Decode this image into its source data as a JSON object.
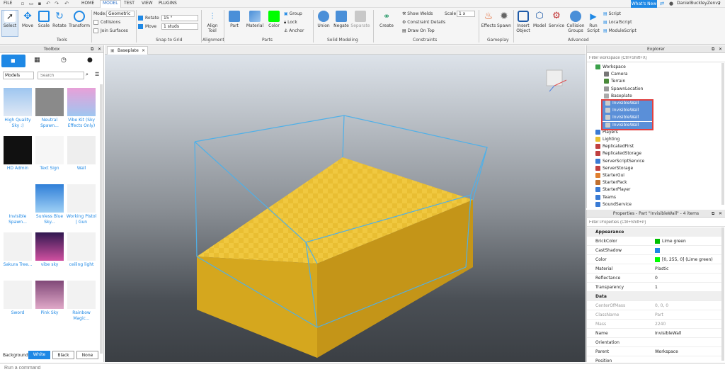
{
  "menu": {
    "file": "FILE",
    "home": "HOME",
    "model": "MODEL",
    "test": "TEST",
    "view": "VIEW",
    "plugins": "PLUGINS",
    "whats_new": "What's New",
    "user": "DanielBuckleyZenva"
  },
  "ribbon": {
    "tools": {
      "select": "Select",
      "move": "Move",
      "scale": "Scale",
      "rotate": "Rotate",
      "transform": "Transform",
      "label": "Tools"
    },
    "mode_label": "Mode:",
    "mode_value": "Geometric",
    "collisions": "Collisions",
    "join_surfaces": "Join Surfaces",
    "rotate": "Rotate",
    "rotate_value": "15 °",
    "move": "Move",
    "move_value": "1 studs",
    "snap_label": "Snap to Grid",
    "align_tool": "Align Tool",
    "alignment_label": "Alignment",
    "part": "Part",
    "material": "Material",
    "color": "Color",
    "group": "Group",
    "lock": "Lock",
    "anchor": "Anchor",
    "parts_label": "Parts",
    "color_swatch": "#00ff00",
    "union": "Union",
    "negate": "Negate",
    "separate": "Separate",
    "solid_label": "Solid Modeling",
    "create": "Create",
    "show_welds": "Show Welds",
    "constraint_details": "Constraint Details",
    "draw_on_top": "Draw On Top",
    "scale": "Scale",
    "scale_value": "1 x",
    "constraints_label": "Constraints",
    "effects": "Effects",
    "spawn": "Spawn",
    "gameplay_label": "Gameplay",
    "insert_object": "Insert Object",
    "model": "Model",
    "service": "Service",
    "collision_groups": "Collision Groups",
    "run_script": "Run Script",
    "script": "Script",
    "local_script": "LocalScript",
    "module_script": "ModuleScript",
    "advanced_label": "Advanced"
  },
  "toolbox": {
    "title": "Toolbox",
    "category": "Models",
    "search_placeholder": "Search",
    "items": [
      "High Quality Sky :)",
      "Neutral Spawn...",
      "Vibe Kit (Sky Effects Only)",
      "HD Admin",
      "Text Sign",
      "Wall",
      "Invisible Spawn...",
      "Sunless Blue Sky...",
      "Working Pistol | Gun",
      "Sakura Tree...",
      "vibe sky",
      "ceiling light",
      "Sword",
      "Pink Sky",
      "Rainbow Magic..."
    ],
    "background_label": "Background:",
    "bg_white": "White",
    "bg_black": "Black",
    "bg_none": "None"
  },
  "tab": {
    "label": "Baseplate",
    "close": "×"
  },
  "explorer": {
    "title": "Explorer",
    "filter": "Filter workspace (Ctrl+Shift+X)",
    "items": [
      {
        "name": "Workspace",
        "indent": 0,
        "color": "#3aa04a"
      },
      {
        "name": "Camera",
        "indent": 1,
        "color": "#777"
      },
      {
        "name": "Terrain",
        "indent": 1,
        "color": "#4a8a3a"
      },
      {
        "name": "SpawnLocation",
        "indent": 1,
        "color": "#999"
      },
      {
        "name": "Baseplate",
        "indent": 1,
        "color": "#aaa"
      },
      {
        "name": "InvisibleWall",
        "indent": 1,
        "color": "#ccc",
        "sel": true
      },
      {
        "name": "InvisibleWall",
        "indent": 1,
        "color": "#ccc",
        "sel": true
      },
      {
        "name": "InvisibleWall",
        "indent": 1,
        "color": "#ccc",
        "sel": true
      },
      {
        "name": "InvisibleWall",
        "indent": 1,
        "color": "#ccc",
        "sel": true
      },
      {
        "name": "Players",
        "indent": 0,
        "color": "#3a7bd5"
      },
      {
        "name": "Lighting",
        "indent": 0,
        "color": "#e8c030"
      },
      {
        "name": "ReplicatedFirst",
        "indent": 0,
        "color": "#c04040"
      },
      {
        "name": "ReplicatedStorage",
        "indent": 0,
        "color": "#c04040"
      },
      {
        "name": "ServerScriptService",
        "indent": 0,
        "color": "#3a7bd5"
      },
      {
        "name": "ServerStorage",
        "indent": 0,
        "color": "#c04040"
      },
      {
        "name": "StarterGui",
        "indent": 0,
        "color": "#e08030"
      },
      {
        "name": "StarterPack",
        "indent": 0,
        "color": "#c07030"
      },
      {
        "name": "StarterPlayer",
        "indent": 0,
        "color": "#3a7bd5"
      },
      {
        "name": "Teams",
        "indent": 0,
        "color": "#3a7bd5"
      },
      {
        "name": "SoundService",
        "indent": 0,
        "color": "#3a7bd5"
      }
    ]
  },
  "properties": {
    "title": "Properties - Part \"InvisibleWall\" - 4 items",
    "filter": "Filter Properties (Ctrl+Shift+P)",
    "rows": [
      {
        "k": "Appearance",
        "section": true
      },
      {
        "k": "BrickColor",
        "v": "Lime green",
        "sw": "#00c000"
      },
      {
        "k": "CastShadow",
        "v": "",
        "check": true
      },
      {
        "k": "Color",
        "v": "[0, 255, 0] (Lime green)",
        "sw": "#00ff00"
      },
      {
        "k": "Material",
        "v": "Plastic"
      },
      {
        "k": "Reflectance",
        "v": "0"
      },
      {
        "k": "Transparency",
        "v": "1"
      },
      {
        "k": "Data",
        "section": true
      },
      {
        "k": "CenterOfMass",
        "v": "0, 0, 0",
        "dim": true
      },
      {
        "k": "ClassName",
        "v": "Part",
        "dim": true
      },
      {
        "k": "Mass",
        "v": "2240",
        "dim": true
      },
      {
        "k": "Name",
        "v": "InvisibleWall"
      },
      {
        "k": "Orientation",
        "v": ""
      },
      {
        "k": "Parent",
        "v": "Workspace"
      },
      {
        "k": "Position",
        "v": ""
      }
    ]
  },
  "command": {
    "placeholder": "Run a command"
  }
}
